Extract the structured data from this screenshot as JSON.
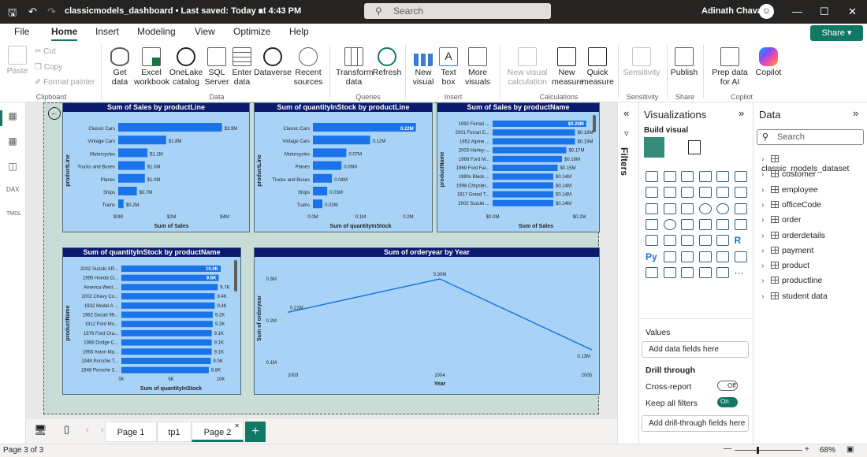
{
  "window": {
    "title": "classicmodels_dashboard • Last saved: Today at 4:43 PM",
    "search_placeholder": "Search",
    "user": "Adinath Chavan"
  },
  "tabs": [
    "File",
    "Home",
    "Insert",
    "Modeling",
    "View",
    "Optimize",
    "Help"
  ],
  "share_label": "Share",
  "ribbon": {
    "clipboard": {
      "paste": "Paste",
      "cut": "Cut",
      "copy": "Copy",
      "format_painter": "Format painter",
      "group": "Clipboard"
    },
    "data": {
      "get_data": "Get data",
      "excel": "Excel workbook",
      "onelake": "OneLake catalog",
      "sql": "SQL Server",
      "enter": "Enter data",
      "dataverse": "Dataverse",
      "recent": "Recent sources",
      "group": "Data"
    },
    "queries": {
      "transform": "Transform data",
      "refresh": "Refresh",
      "group": "Queries"
    },
    "insert": {
      "new_visual": "New visual",
      "text_box": "Text box",
      "more": "More visuals",
      "group": "Insert"
    },
    "calculations": {
      "new_calc": "New visual calculation",
      "new_measure": "New measure",
      "quick_measure": "Quick measure",
      "group": "Calculations"
    },
    "sensitivity": {
      "label": "Sensitivity",
      "group": "Sensitivity"
    },
    "share": {
      "publish": "Publish",
      "group": "Share"
    },
    "copilot": {
      "prep": "Prep data for AI",
      "copilot": "Copilot",
      "group": "Copilot"
    }
  },
  "visuals": {
    "v1": {
      "title": "Sum of Sales by productLine",
      "xlabel": "Sum of Sales",
      "ylabel": "productLine"
    },
    "v2": {
      "title": "Sum of quantityInStock by productLine",
      "xlabel": "Sum of quantityInStock",
      "ylabel": "productLine"
    },
    "v3": {
      "title": "Sum of Sales by productName",
      "xlabel": "Sum of Sales",
      "ylabel": "productName"
    },
    "v4": {
      "title": "Sum of quantityInStock by productName",
      "xlabel": "Sum of quantityInStock",
      "ylabel": "productName"
    },
    "v5": {
      "title": "Sum of orderyear by Year",
      "xlabel": "Year",
      "ylabel": "Sum of orderyear"
    }
  },
  "chart_data": [
    {
      "type": "bar",
      "categories": [
        "Classic Cars",
        "Vintage Cars",
        "Motorcycles",
        "Trucks and Buses",
        "Planes",
        "Ships",
        "Trains"
      ],
      "values": [
        3.9,
        1.8,
        1.1,
        1.0,
        1.0,
        0.7,
        0.2
      ],
      "data_labels": [
        "$3.9M",
        "$1.8M",
        "$1.1M",
        "$1.0M",
        "$1.0M",
        "$0.7M",
        "$0.2M"
      ],
      "ticks": [
        "$0M",
        "$2M",
        "$4M"
      ],
      "xlim": [
        0,
        4
      ]
    },
    {
      "type": "bar",
      "categories": [
        "Classic Cars",
        "Vintage Cars",
        "Motorcycles",
        "Planes",
        "Trucks and Buses",
        "Ships",
        "Trains"
      ],
      "values": [
        0.22,
        0.12,
        0.07,
        0.06,
        0.04,
        0.03,
        0.02
      ],
      "data_labels": [
        "0.22M",
        "0.12M",
        "0.07M",
        "0.06M",
        "0.04M",
        "0.03M",
        "0.02M"
      ],
      "ticks": [
        "0.0M",
        "0.1M",
        "0.2M"
      ],
      "xlim": [
        0,
        0.2
      ]
    },
    {
      "type": "bar",
      "categories": [
        "1992 Ferrari ...",
        "2001 Ferrari E...",
        "1952 Alpine ...",
        "2003 Harley-...",
        "1968 Ford M...",
        "1969 Ford Fal...",
        "1980s Black ...",
        "1998 Chrysler...",
        "1917 Grand T...",
        "2002 Suzuki ..."
      ],
      "values": [
        0.28,
        0.19,
        0.19,
        0.17,
        0.16,
        0.15,
        0.14,
        0.14,
        0.14,
        0.14
      ],
      "data_labels": [
        "$0.28M",
        "$0.19M",
        "$0.19M",
        "$0.17M",
        "$0.16M",
        "$0.15M",
        "$0.14M",
        "$0.14M",
        "$0.14M",
        "$0.14M"
      ],
      "ticks": [
        "$0.0M",
        "$0.2M"
      ],
      "xlim": [
        0,
        0.2
      ]
    },
    {
      "type": "bar",
      "categories": [
        "2002 Suzuki XR...",
        "1995 Honda Ci...",
        "America West ...",
        "2002 Chevy Co...",
        "1932 Model A ...",
        "1982 Ducati 99...",
        "1912 Ford Mo...",
        "1976 Ford Gra...",
        "1968 Dodge C...",
        "1965 Aston Ma...",
        "1948 Porsche T...",
        "1948 Porsche 3..."
      ],
      "values": [
        10.0,
        9.8,
        9.7,
        9.4,
        9.4,
        9.2,
        9.2,
        9.1,
        9.1,
        9.1,
        9.0,
        8.8
      ],
      "data_labels": [
        "10.0K",
        "9.8K",
        "9.7K",
        "9.4K",
        "9.4K",
        "9.2K",
        "9.2K",
        "9.1K",
        "9.1K",
        "9.1K",
        "9.0K",
        "8.8K"
      ],
      "ticks": [
        "0K",
        "5K",
        "10K"
      ],
      "xlim": [
        0,
        10
      ]
    },
    {
      "type": "line",
      "x": [
        "2003",
        "2004",
        "2005"
      ],
      "values": [
        0.22,
        0.3,
        0.13
      ],
      "data_labels": [
        "0.22M",
        "0.30M",
        "0.13M"
      ],
      "yticks": [
        "0.3M",
        "0.2M",
        "0.1M"
      ],
      "ylim": [
        0.1,
        0.3
      ]
    }
  ],
  "page_tabs": [
    "Page 1",
    "tp1",
    "Page 2"
  ],
  "status": {
    "page": "Page 3 of 3",
    "zoom": "68%"
  },
  "filters_label": "Filters",
  "viz_pane": {
    "title": "Visualizations",
    "build": "Build visual",
    "values": "Values",
    "add_fields": "Add data fields here",
    "drill": "Drill through",
    "cross": "Cross-report",
    "cross_state": "Off",
    "keep": "Keep all filters",
    "keep_state": "On",
    "add_drill": "Add drill-through fields here"
  },
  "data_pane": {
    "title": "Data",
    "search": "Search",
    "tables": [
      "classic_models_dataset",
      "customer",
      "employee",
      "officeCode",
      "order",
      "orderdetails",
      "payment",
      "product",
      "productline",
      "student data"
    ]
  }
}
